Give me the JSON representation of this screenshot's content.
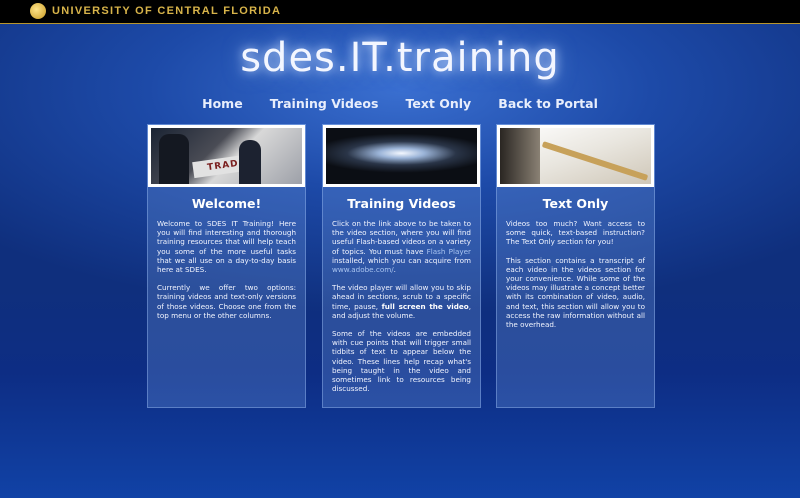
{
  "topbar": {
    "university": "UNIVERSITY OF CENTRAL FLORIDA"
  },
  "site": {
    "title": "sdes.IT.training"
  },
  "nav": {
    "items": [
      "Home",
      "Training Videos",
      "Text Only",
      "Back to Portal"
    ]
  },
  "columns": {
    "welcome": {
      "heading": "Welcome!",
      "p1": "Welcome to SDES IT Training! Here you will find interesting and thorough training resources that will help teach you some of the more useful tasks that we all use on a day-to-day basis here at SDES.",
      "p2": "Currently we offer two options: training videos and text-only versions of those videos. Choose one from the top menu or the other columns."
    },
    "videos": {
      "heading": "Training Videos",
      "p1a": "Click on the link above to be taken to the video section, where you will find useful Flash-based videos on a variety of topics. You must have ",
      "p1_link": "Flash Player",
      "p1b": " installed, which you can acquire from ",
      "p1_link2": "www.adobe.com/",
      "p1c": ".",
      "p2a": "The video player will allow you to skip ahead in sections, scrub to a specific time, pause, ",
      "p2_bold": "full screen the video",
      "p2b": ", and adjust the volume.",
      "p3": "Some of the videos are embedded with cue points that will trigger small tidbits of text to appear below the video. These lines help recap what's being taught in the video and sometimes link to resources being discussed."
    },
    "textonly": {
      "heading": "Text Only",
      "p1": "Videos too much? Want access to some quick, text-based instruction? The Text Only section for you!",
      "p2": "This section contains a transcript of each video in the videos section for your convenience. While some of the videos may illustrate a concept better with its combination of video, audio, and text, this section will allow you to access the raw information without all the overhead."
    }
  },
  "images": {
    "sign_text": "TRAD"
  },
  "colors": {
    "accent_gold": "#d8b44a",
    "background": "#1d4aa8",
    "panel": "#4f72c0"
  }
}
